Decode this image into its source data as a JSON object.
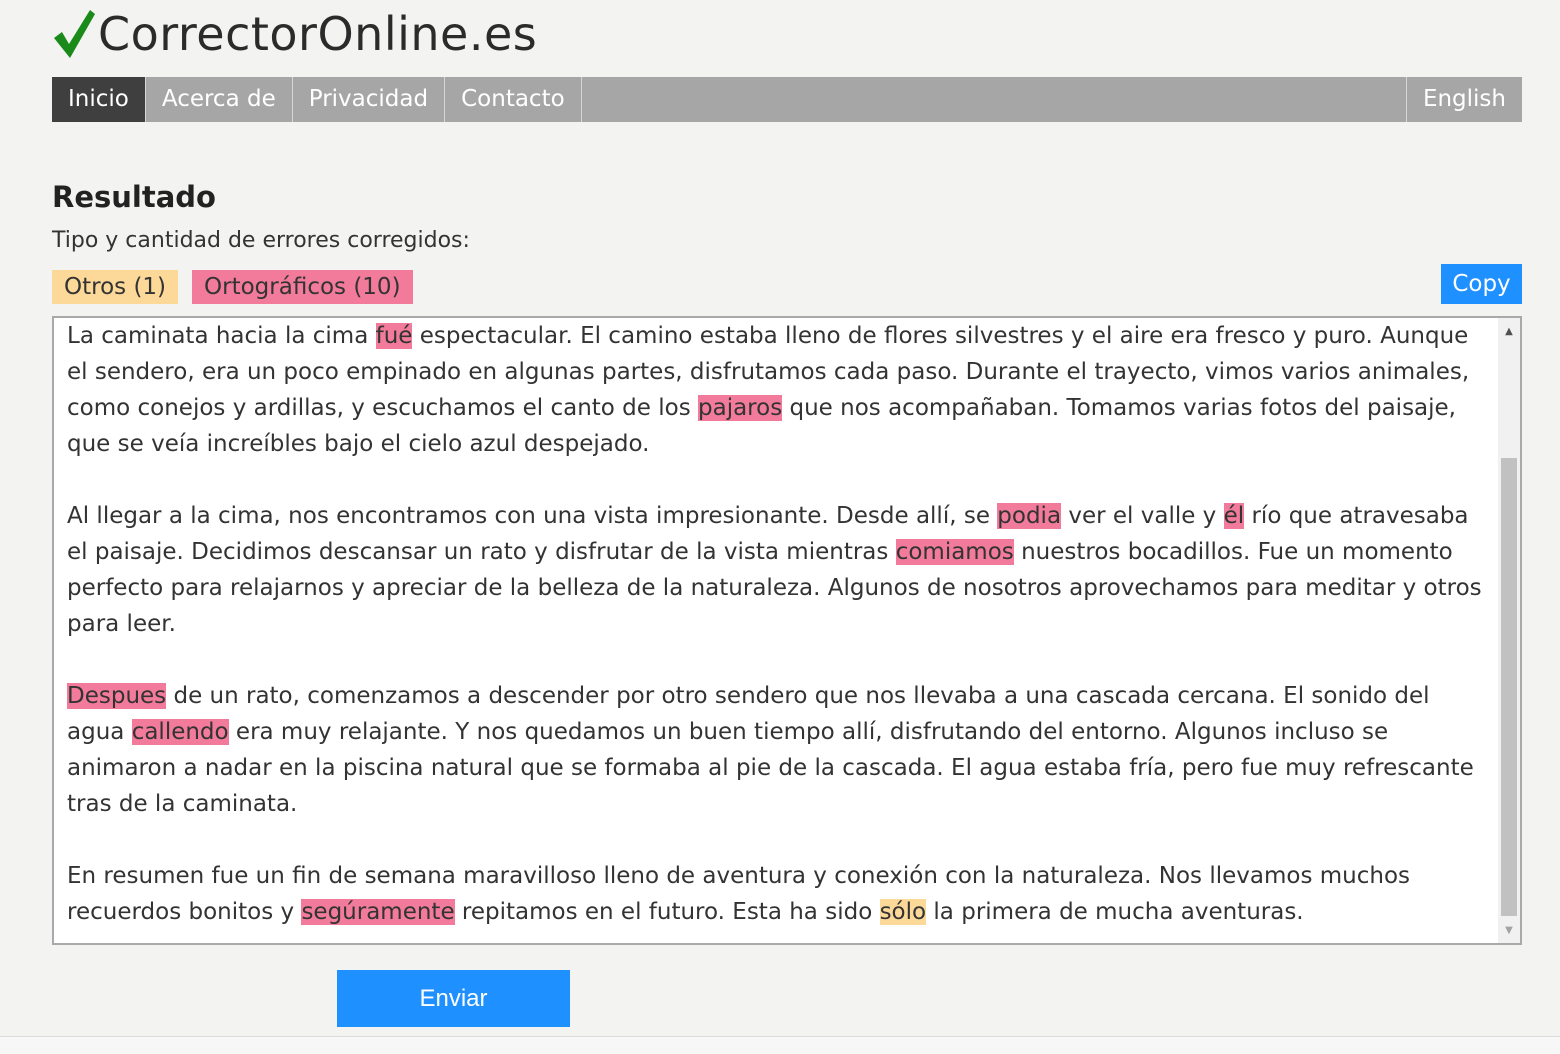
{
  "site": {
    "logo_icon": "checkmark-icon",
    "brand_color": "#1a8a1a",
    "name": "CorrectorOnline.es"
  },
  "nav": {
    "items": [
      "Inicio",
      "Acerca de",
      "Privacidad",
      "Contacto"
    ],
    "active": "Inicio",
    "language": "English"
  },
  "result": {
    "title": "Resultado",
    "subtitle": "Tipo y cantidad de errores corregidos:",
    "badge_otros": "Otros (1)",
    "badge_ortograficos": "Ortográficos (10)",
    "copy_label": "Copy",
    "colors": {
      "otros": "#fcd999",
      "ortograficos": "#f27b9b"
    }
  },
  "text": {
    "paragraphs": [
      [
        {
          "t": "La caminata hacia la cima "
        },
        {
          "t": "fué",
          "hl": "orto"
        },
        {
          "t": " espectacular. El camino estaba lleno de flores silvestres y el aire era fresco y puro. Aunque el sendero, era un poco empinado en algunas partes, disfrutamos cada paso. Durante el trayecto, vimos varios animales, como conejos y ardillas, y escuchamos el canto de los "
        },
        {
          "t": "pajaros",
          "hl": "orto"
        },
        {
          "t": " que nos acompañaban. Tomamos varias fotos del paisaje, que se veía increíbles bajo el cielo azul despejado."
        }
      ],
      [
        {
          "t": "Al llegar a la cima, nos encontramos con una vista impresionante. Desde allí, se "
        },
        {
          "t": "podia",
          "hl": "orto"
        },
        {
          "t": " ver el valle y "
        },
        {
          "t": "él",
          "hl": "orto"
        },
        {
          "t": " río que atravesaba el paisaje. Decidimos descansar un rato y disfrutar de la vista mientras "
        },
        {
          "t": "comiamos",
          "hl": "orto"
        },
        {
          "t": " nuestros bocadillos. Fue un momento perfecto para relajarnos y apreciar de la belleza de la naturaleza. Algunos de nosotros aprovechamos para meditar y otros para leer."
        }
      ],
      [
        {
          "t": "Despues",
          "hl": "orto"
        },
        {
          "t": " de un rato, comenzamos a descender por otro sendero que nos llevaba a una cascada cercana. El sonido del agua "
        },
        {
          "t": "callendo",
          "hl": "orto"
        },
        {
          "t": " era muy relajante. Y nos quedamos un buen tiempo allí, disfrutando del entorno. Algunos incluso se animaron a nadar en la piscina natural que se formaba al pie de la cascada. El agua estaba fría, pero fue muy refrescante tras de la caminata."
        }
      ],
      [
        {
          "t": "En resumen fue un fin de semana maravilloso lleno de aventura y conexión con la naturaleza. Nos llevamos muchos recuerdos bonitos y "
        },
        {
          "t": "segúramente",
          "hl": "orto"
        },
        {
          "t": " repitamos en el futuro. Esta ha sido "
        },
        {
          "t": "sólo",
          "hl": "otros"
        },
        {
          "t": " la primera de mucha aventuras."
        }
      ]
    ]
  },
  "submit_label": "Enviar"
}
